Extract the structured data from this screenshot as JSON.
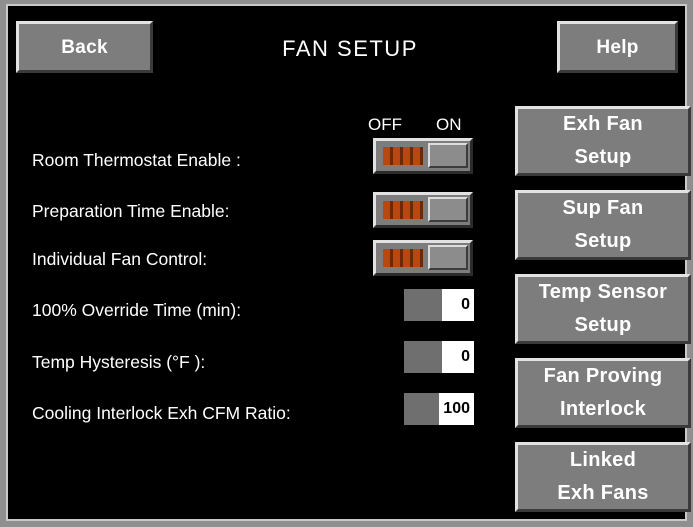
{
  "header": {
    "back_label": "Back",
    "title": "FAN SETUP",
    "help_label": "Help"
  },
  "toggle_header": {
    "off": "OFF",
    "on": "ON"
  },
  "settings": {
    "room_thermostat": {
      "label": "Room Thermostat Enable :",
      "state": "OFF"
    },
    "prep_time": {
      "label": "Preparation Time Enable:",
      "state": "OFF"
    },
    "individual_fan": {
      "label": "Individual Fan Control:",
      "state": "OFF"
    },
    "override_time": {
      "label": "100% Override Time (min):",
      "value": "0"
    },
    "hysteresis": {
      "label": "Temp Hysteresis (°F ):",
      "value": "0"
    },
    "cfm_ratio": {
      "label": "Cooling Interlock Exh CFM Ratio:",
      "value": "100"
    }
  },
  "side_buttons": {
    "exh_fan": [
      "Exh Fan",
      "Setup"
    ],
    "sup_fan": [
      "Sup Fan",
      "Setup"
    ],
    "temp_sensor": [
      "Temp Sensor",
      "Setup"
    ],
    "fan_proving": [
      "Fan Proving",
      "Interlock"
    ],
    "linked_exh": [
      "Linked",
      "Exh Fans"
    ]
  },
  "colors": {
    "background": "#000000",
    "button": "#7d7d7d",
    "toggle_off_fill": "#b84812"
  }
}
